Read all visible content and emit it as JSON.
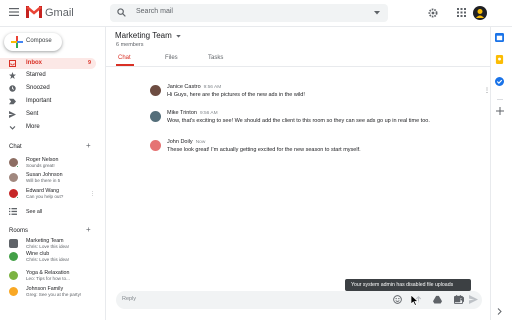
{
  "header": {
    "app_name": "Gmail",
    "search_placeholder": "Search mail",
    "icons": [
      "menu-icon",
      "gmail-logo-icon",
      "search-icon",
      "dropdown-icon",
      "gear-icon",
      "apps-icon",
      "account-icon"
    ]
  },
  "sidebar": {
    "compose_label": "Compose",
    "nav": [
      {
        "label": "Inbox",
        "count": "9",
        "icon": "inbox-icon",
        "active": true
      },
      {
        "label": "Starred",
        "icon": "star-icon"
      },
      {
        "label": "Snoozed",
        "icon": "clock-icon"
      },
      {
        "label": "Important",
        "icon": "important-icon"
      },
      {
        "label": "Sent",
        "icon": "send-icon"
      },
      {
        "label": "More",
        "icon": "chevron-down-icon"
      }
    ],
    "chat": {
      "title": "Chat",
      "people": [
        {
          "name": "Roger Nelson",
          "status": "Sounds great!",
          "color": "#8d6e63",
          "online": true
        },
        {
          "name": "Susan Johnson",
          "status": "Will be there in 5",
          "color": "#a1887f",
          "online": false
        },
        {
          "name": "Edward Wang",
          "status": "Can you help out?",
          "color": "#c62828",
          "online": true
        }
      ],
      "see_all": "See all"
    },
    "rooms": {
      "title": "Rooms",
      "items": [
        {
          "name": "Marketing Team",
          "last": "Chris: Love this idea!",
          "color": "#5f6368"
        },
        {
          "name": "Wine club",
          "last": "Chris: Love this idea!",
          "color": "#43a047"
        },
        {
          "name": "Yoga & Relaxation",
          "last": "Leo: Tips for how to...",
          "color": "#7cb342"
        },
        {
          "name": "Johnson Family",
          "last": "Greg: See you at the party!",
          "color": "#f9a825"
        }
      ]
    }
  },
  "room": {
    "title": "Marketing Team",
    "members": "6 members",
    "tabs": [
      {
        "label": "Chat",
        "active": true
      },
      {
        "label": "Files"
      },
      {
        "label": "Tasks"
      }
    ]
  },
  "messages": [
    {
      "author": "Janice Castro",
      "time": "9:56 AM",
      "text": "Hi Guys, here are the pictures of the new ads in the wild!",
      "color": "#6d4c41"
    },
    {
      "author": "Mike Trinton",
      "time": "9:56 AM",
      "text": "Wow, that's exciting to see! We should add the client to this room so they can see ads go up in real time too.",
      "color": "#546e7a"
    },
    {
      "author": "John Doily",
      "time": "Now",
      "text": "These look great! I'm actually getting excited for the new season to start myself.",
      "color": "#e57373"
    }
  ],
  "reply": {
    "placeholder": "Reply",
    "tooltip": "Your system admin has disabled file uploads"
  },
  "colors": {
    "accent": "#d93025",
    "active_bg": "#fce8e6",
    "surface": "#f1f3f4",
    "tooltip_bg": "#3c4043"
  }
}
